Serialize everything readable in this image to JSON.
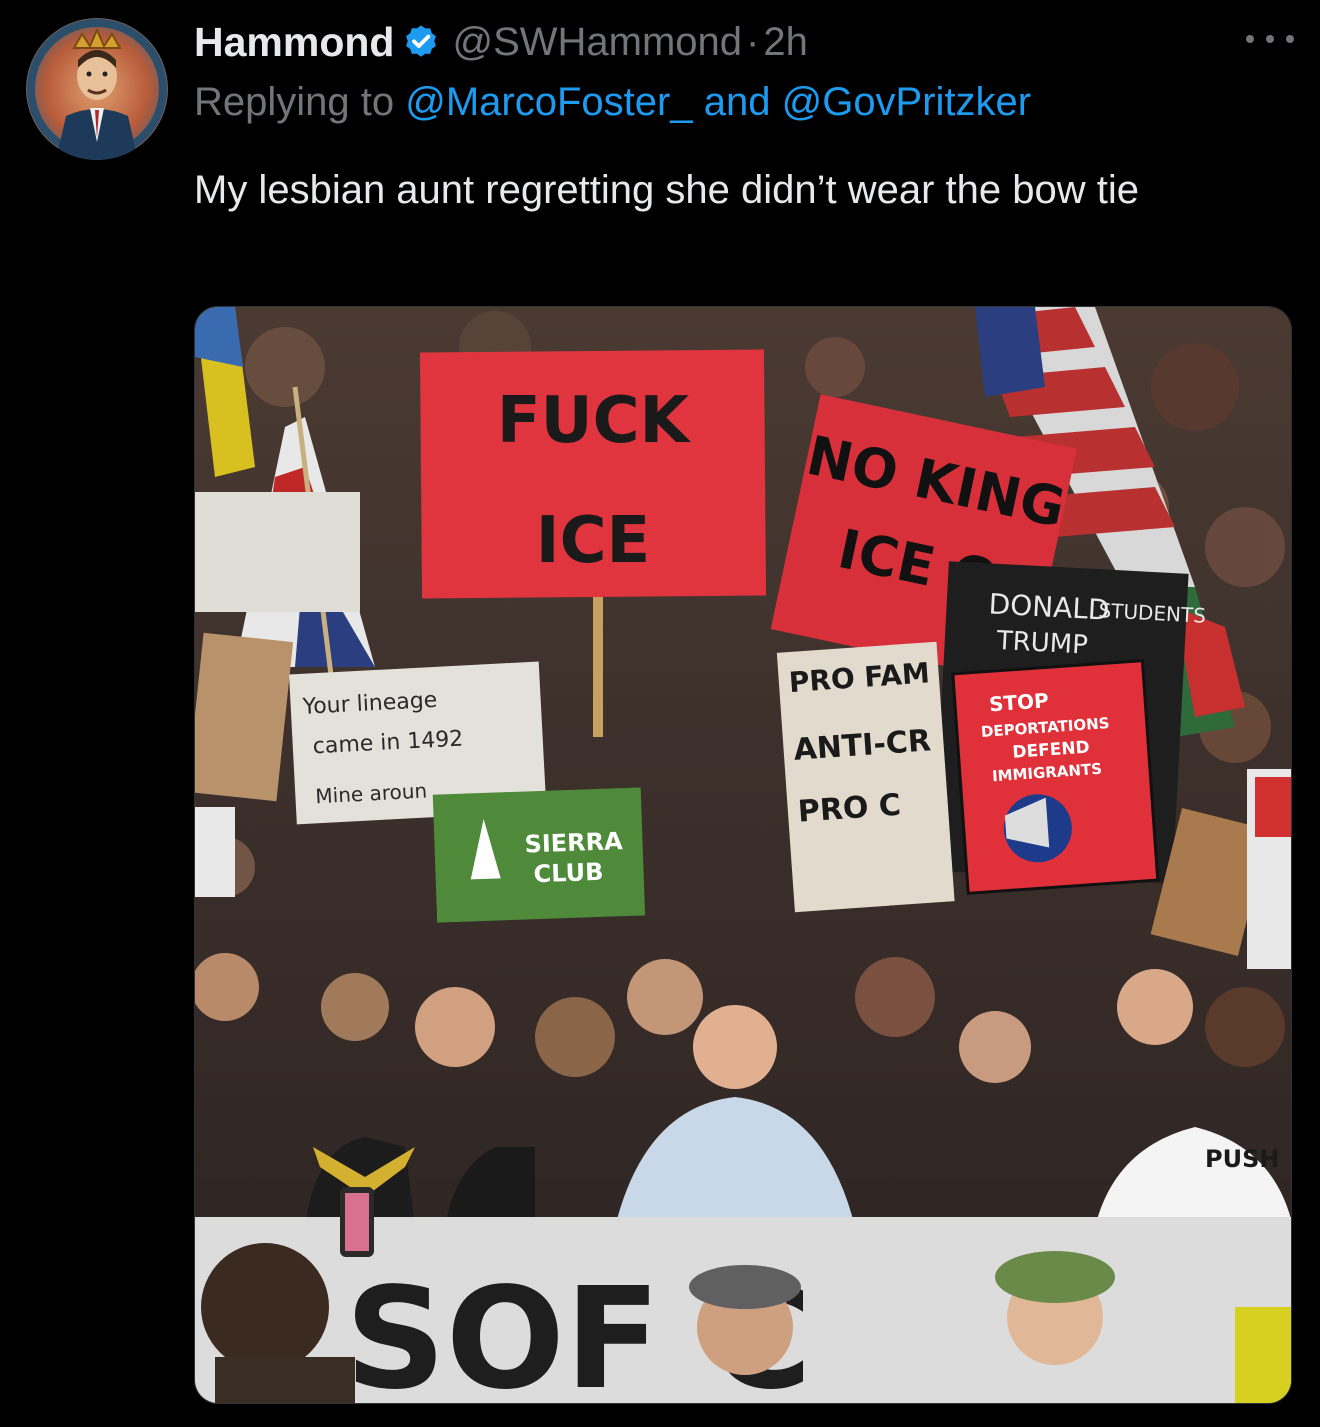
{
  "tweet": {
    "display_name": "Hammond",
    "handle": "@SWHammond",
    "separator": "·",
    "time": "2h",
    "replying_prefix": "Replying to",
    "reply_to_1": "@MarcoFoster_",
    "reply_joiner": "and",
    "reply_to_2": "@GovPritzker",
    "text": "My lesbian aunt regretting she didn’t wear the bow tie"
  },
  "icons": {
    "verified": "verified-badge-icon",
    "more": "more-options-icon"
  },
  "colors": {
    "background": "#000000",
    "primary_text": "#e7e9ea",
    "secondary_text": "#71767b",
    "link": "#1d9bf0",
    "verified_badge": "#1d9bf0"
  },
  "media": {
    "signs": {
      "sign1_line1": "FUCK",
      "sign1_line2": "ICE",
      "sign2_line1": "NO KING",
      "sign2_line2": "ICE O",
      "sign3_line1": "DONALD",
      "sign3_line2": "TRUMP",
      "sign3_extra": "STUDENTS",
      "sign4_line1": "STOP",
      "sign4_line2": "DEPORTATIONS",
      "sign4_line3": "DEFEND",
      "sign4_line4": "IMMIGRANTS",
      "sign5_line1": "SIERRA",
      "sign5_line2": "CLUB",
      "sign6_line1": "Your lineage",
      "sign6_line2": "came in 1492",
      "sign6_line3": "Mine aroun",
      "sign7_line1": "PRO FAM",
      "sign7_line2": "ANTI-CR",
      "sign7_line3": "PRO C",
      "banner_text": "SOF C",
      "shirt_text": "PUSH"
    }
  }
}
